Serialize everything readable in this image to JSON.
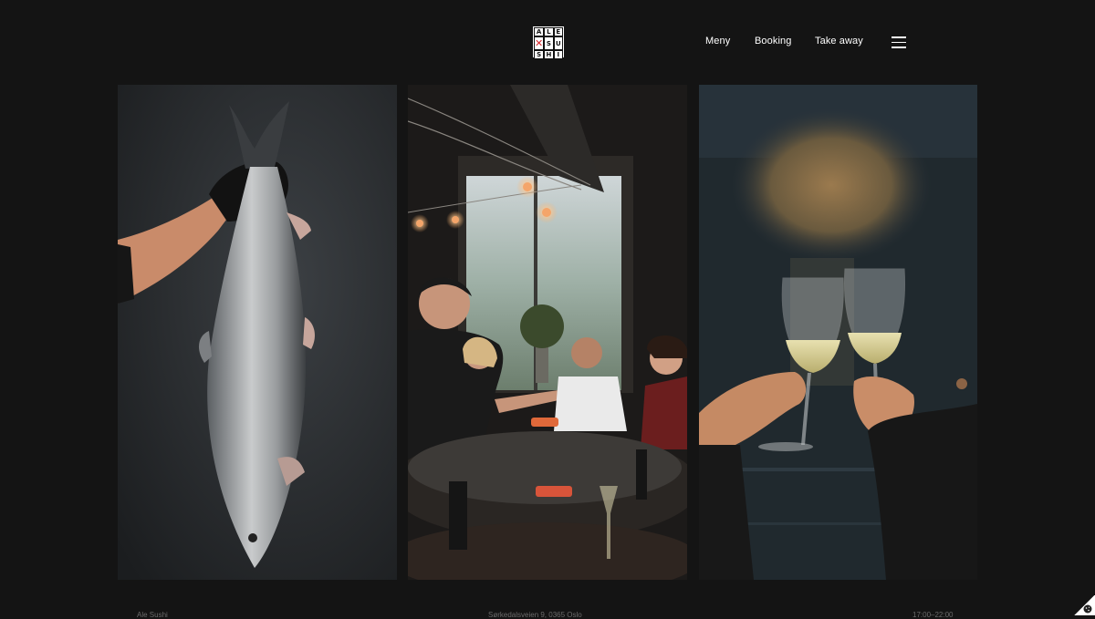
{
  "header": {
    "logo_letters": [
      "A",
      "L",
      "E",
      "",
      "X",
      "S",
      "U",
      "",
      "H",
      "I"
    ],
    "logo_text": "ALE SUSHI",
    "nav": {
      "meny": "Meny",
      "booking": "Booking",
      "takeaway": "Take away"
    },
    "menu_icon": "hamburger-icon"
  },
  "gallery": {
    "photos": [
      {
        "subject": "salmon-photo"
      },
      {
        "subject": "sushi-bar-photo"
      },
      {
        "subject": "wine-toast-photo"
      }
    ]
  },
  "footer": {
    "left": "Ale Sushi",
    "center": "Sørkedalsveien 9, 0365 Oslo",
    "right": "17:00–22:00"
  },
  "colors": {
    "background": "#141414",
    "logo_accent": "#d6262b",
    "text": "#ffffff"
  },
  "cookie_icon": "cookie-icon"
}
